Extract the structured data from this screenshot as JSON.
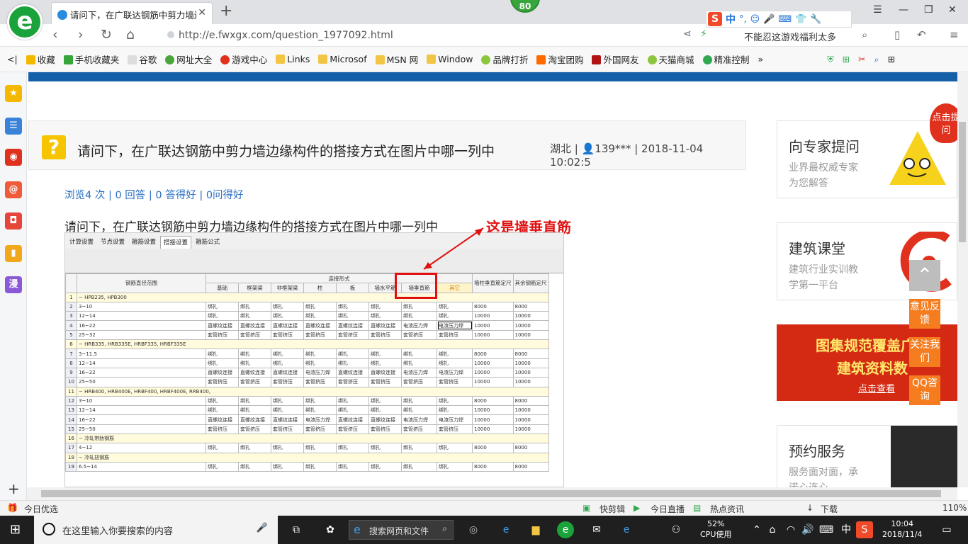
{
  "browser": {
    "tab_title": "请问下，在广联达钢筋中剪力墙边缘构件的搭接方式在图片中哪一列中",
    "badge": "80",
    "url": "http://e.fwxgx.com/question_1977092.html",
    "url_hint": "不能忍这游戏福利太多",
    "ime": {
      "zh": "中",
      "punct": "°,"
    },
    "bookmarks": [
      "收藏",
      "手机收藏夹",
      "谷歌",
      "网址大全",
      "游戏中心",
      "Links",
      "Microsof",
      "MSN 网",
      "Window",
      "品牌打折",
      "淘宝团购",
      "外国网友",
      "天猫商城",
      "精准控制"
    ],
    "sidebar": {
      "comic": "漫"
    }
  },
  "question": {
    "title": "请问下，在广联达钢筋中剪力墙边缘构件的搭接方式在图片中哪一列中",
    "region": "湖北",
    "user": "139***",
    "datetime": "2018-11-04 10:02:5",
    "stats": "浏览4 次 | 0 回答 | 0 答得好 | 0问得好",
    "body": "请问下，在广联达钢筋中剪力墙边缘构件的搭接方式在图片中哪一列中",
    "annotation": "这是墙垂直筋"
  },
  "screenshot": {
    "tabs": [
      "计算设置",
      "节点设置",
      "箍筋设置",
      "搭接设置",
      "箍筋公式"
    ],
    "active_tab": "搭接设置",
    "header_group": "连接形式",
    "col0": "钢筋直径范围",
    "cols": [
      "基础",
      "框架梁",
      "非框架梁",
      "柱",
      "板",
      "墙水平筋",
      "墙垂直筋",
      "其它"
    ],
    "col_extra": [
      "墙柱垂直筋定尺",
      "其余钢筋定尺"
    ],
    "rows": [
      [
        "1",
        "− HPB235, HPB300",
        "",
        "",
        "",
        "",
        "",
        "",
        "",
        "",
        "",
        ""
      ],
      [
        "2",
        "3~10",
        "绑扎",
        "绑扎",
        "绑扎",
        "绑扎",
        "绑扎",
        "绑扎",
        "绑扎",
        "绑扎",
        "8000",
        "8000"
      ],
      [
        "3",
        "12~14",
        "绑扎",
        "绑扎",
        "绑扎",
        "绑扎",
        "绑扎",
        "绑扎",
        "绑扎",
        "绑扎",
        "10000",
        "10000"
      ],
      [
        "4",
        "16~22",
        "直螺纹连接",
        "直螺纹连接",
        "直螺纹连接",
        "直螺纹连接",
        "直螺纹连接",
        "直螺纹连接",
        "电渣压力焊",
        "电渣压力焊",
        "10000",
        "10000"
      ],
      [
        "5",
        "25~32",
        "套管挤压",
        "套管挤压",
        "套管挤压",
        "套管挤压",
        "套管挤压",
        "套管挤压",
        "套管挤压",
        "套管挤压",
        "10000",
        "10000"
      ],
      [
        "6",
        "− HRB335, HRB335E, HRBF335, HRBF335E",
        "",
        "",
        "",
        "",
        "",
        "",
        "",
        "",
        "",
        ""
      ],
      [
        "7",
        "3~11.5",
        "绑扎",
        "绑扎",
        "绑扎",
        "绑扎",
        "绑扎",
        "绑扎",
        "绑扎",
        "绑扎",
        "8000",
        "8000"
      ],
      [
        "8",
        "12~14",
        "绑扎",
        "绑扎",
        "绑扎",
        "绑扎",
        "绑扎",
        "绑扎",
        "绑扎",
        "绑扎",
        "10000",
        "10000"
      ],
      [
        "9",
        "16~22",
        "直螺纹连接",
        "直螺纹连接",
        "直螺纹连接",
        "电渣压力焊",
        "直螺纹连接",
        "直螺纹连接",
        "电渣压力焊",
        "电渣压力焊",
        "10000",
        "10000"
      ],
      [
        "10",
        "25~50",
        "套管挤压",
        "套管挤压",
        "套管挤压",
        "套管挤压",
        "套管挤压",
        "套管挤压",
        "套管挤压",
        "套管挤压",
        "10000",
        "10000"
      ],
      [
        "11",
        "− HRB400, HRB400E, HRBF400, HRBF400E, RRB400,",
        "",
        "",
        "",
        "",
        "",
        "",
        "",
        "",
        "",
        ""
      ],
      [
        "12",
        "3~10",
        "绑扎",
        "绑扎",
        "绑扎",
        "绑扎",
        "绑扎",
        "绑扎",
        "绑扎",
        "绑扎",
        "8000",
        "8000"
      ],
      [
        "13",
        "12~14",
        "绑扎",
        "绑扎",
        "绑扎",
        "绑扎",
        "绑扎",
        "绑扎",
        "绑扎",
        "绑扎",
        "10000",
        "10000"
      ],
      [
        "14",
        "16~22",
        "直螺纹连接",
        "直螺纹连接",
        "直螺纹连接",
        "电渣压力焊",
        "直螺纹连接",
        "直螺纹连接",
        "电渣压力焊",
        "电渣压力焊",
        "10000",
        "10000"
      ],
      [
        "15",
        "25~50",
        "套管挤压",
        "套管挤压",
        "套管挤压",
        "套管挤压",
        "套管挤压",
        "套管挤压",
        "套管挤压",
        "套管挤压",
        "10000",
        "10000"
      ],
      [
        "16",
        "− 冷轧带肋钢筋",
        "",
        "",
        "",
        "",
        "",
        "",
        "",
        "",
        "",
        ""
      ],
      [
        "17",
        "4~12",
        "绑扎",
        "绑扎",
        "绑扎",
        "绑扎",
        "绑扎",
        "绑扎",
        "绑扎",
        "绑扎",
        "8000",
        "8000"
      ],
      [
        "18",
        "− 冷轧扭钢筋",
        "",
        "",
        "",
        "",
        "",
        "",
        "",
        "",
        "",
        ""
      ],
      [
        "19",
        "6.5~14",
        "绑扎",
        "绑扎",
        "绑扎",
        "绑扎",
        "绑扎",
        "绑扎",
        "绑扎",
        "绑扎",
        "8000",
        "8000"
      ]
    ]
  },
  "right": {
    "card1_title": "向专家提问",
    "card1_sub1": "业界最权威专家",
    "card1_sub2": "为您解答",
    "card2_title": "建筑课堂",
    "card2_sub1": "建筑行业实训教",
    "card2_sub2": "学第一平台",
    "banner1": "图集规范覆盖广",
    "banner2": "建筑资料数",
    "banner3": "点击查看",
    "card3_title": "预约服务",
    "card3_sub1": "服务面对面，承",
    "card3_sub2": "诺心连心",
    "corner": "点击提问",
    "float_feedback": "意见反馈",
    "float_follow": "关注我们",
    "float_qq": "QQ咨询"
  },
  "statusbar": {
    "left": "今日优选",
    "clip": "快剪辑",
    "live": "今日直播",
    "news": "热点资讯",
    "download": "下载",
    "zoom": "110%"
  },
  "taskbar": {
    "search": "在这里输入你要搜索的内容",
    "ie_search": "搜索网页和文件",
    "cpu_pct": "52%",
    "cpu_label": "CPU使用",
    "lang": "中",
    "time": "10:04",
    "date": "2018/11/4"
  }
}
